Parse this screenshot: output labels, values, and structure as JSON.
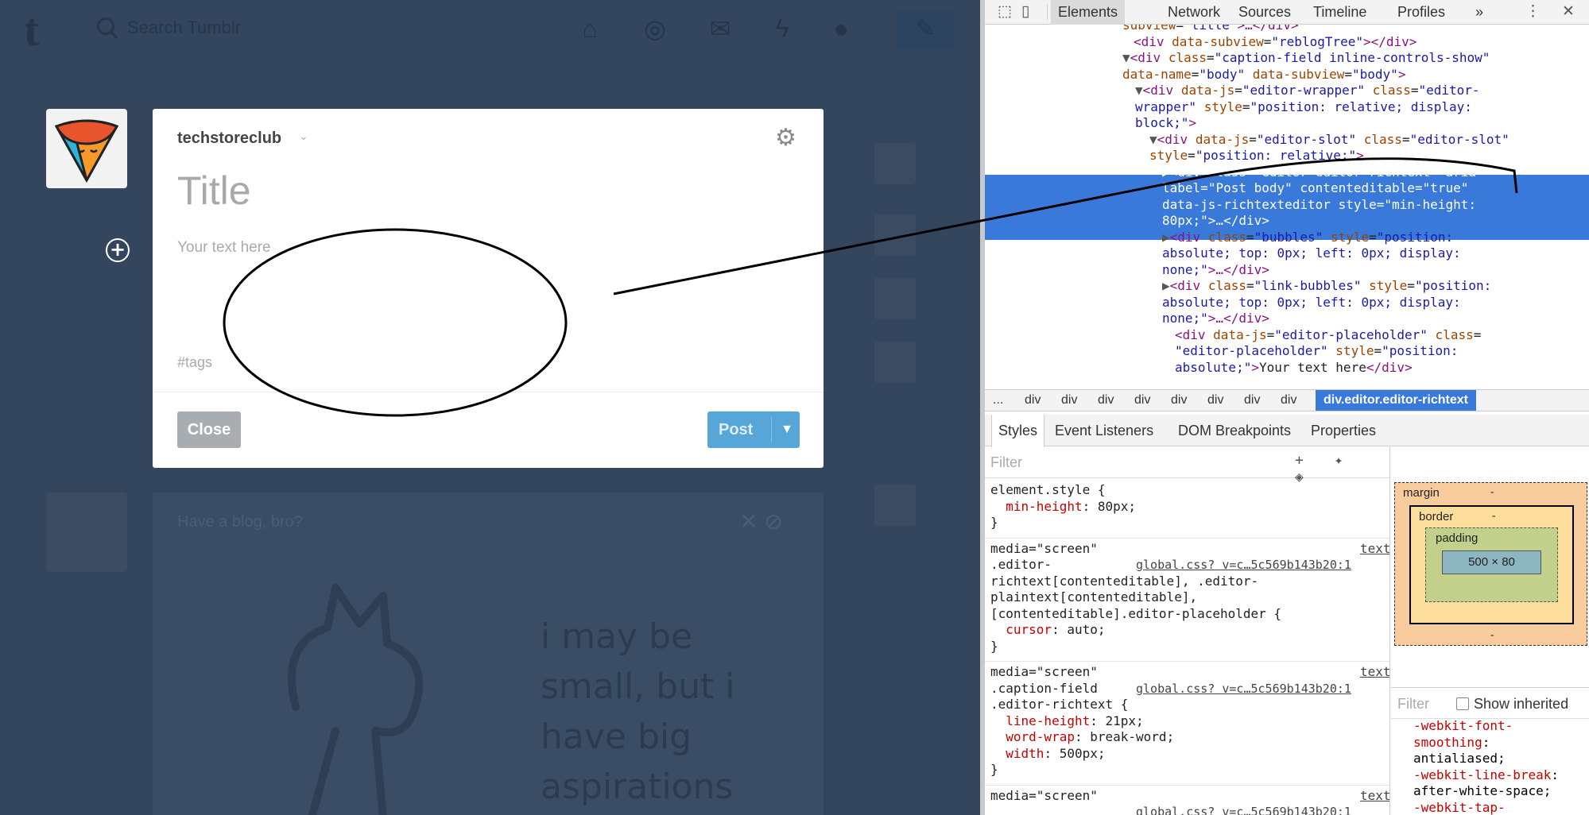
{
  "dashboard": {
    "search_placeholder": "Search Tumblr",
    "nav_icons": [
      "home-icon",
      "explore-icon",
      "inbox-icon",
      "activity-icon",
      "account-icon",
      "compose-icon"
    ]
  },
  "composer": {
    "blog_name": "techstoreclub",
    "title_placeholder": "Title",
    "body_placeholder": "Your text here",
    "tags_placeholder": "#tags",
    "close_label": "Close",
    "post_label": "Post"
  },
  "background_post": {
    "title": "Have a blog, bro?",
    "text": "i may be small, but i have big aspirations"
  },
  "devtools": {
    "tabs": [
      "Elements",
      "Network",
      "Sources",
      "Timeline",
      "Profiles",
      "»"
    ],
    "active_tab": "Elements",
    "dom_lines": [
      {
        "ind": 180,
        "t": [
          [
            "attr",
            "subview"
          ],
          [
            "txt",
            "="
          ],
          [
            "val",
            "\"title\""
          ],
          [
            "tag",
            ">…</div>"
          ]
        ]
      },
      {
        "ind": 194,
        "t": [
          [
            "tag",
            "<div "
          ],
          [
            "attr",
            "data-subview"
          ],
          [
            "txt",
            "="
          ],
          [
            "val",
            "\"reblogTree\""
          ],
          [
            "tag",
            "></div>"
          ]
        ]
      },
      {
        "ind": 180,
        "t": [
          [
            "tri",
            "▼"
          ],
          [
            "tag",
            "<div "
          ],
          [
            "attr",
            "class"
          ],
          [
            "txt",
            "="
          ],
          [
            "val",
            "\"caption-field inline-controls-show\""
          ]
        ]
      },
      {
        "ind": 180,
        "t": [
          [
            "attr",
            "data-name"
          ],
          [
            "txt",
            "="
          ],
          [
            "val",
            "\"body\" "
          ],
          [
            "attr",
            "data-subview"
          ],
          [
            "txt",
            "="
          ],
          [
            "val",
            "\"body\""
          ],
          [
            "tag",
            ">"
          ]
        ]
      },
      {
        "ind": 196,
        "t": [
          [
            "tri",
            "▼"
          ],
          [
            "tag",
            "<div "
          ],
          [
            "attr",
            "data-js"
          ],
          [
            "txt",
            "="
          ],
          [
            "val",
            "\"editor-wrapper\" "
          ],
          [
            "attr",
            "class"
          ],
          [
            "txt",
            "="
          ],
          [
            "val",
            "\"editor-"
          ]
        ]
      },
      {
        "ind": 196,
        "t": [
          [
            "val",
            "wrapper\" "
          ],
          [
            "attr",
            "style"
          ],
          [
            "txt",
            "="
          ],
          [
            "val",
            "\"position: relative; display:"
          ]
        ]
      },
      {
        "ind": 196,
        "t": [
          [
            "val",
            "block;\""
          ],
          [
            "tag",
            ">"
          ]
        ]
      },
      {
        "ind": 214,
        "t": [
          [
            "tri",
            "▼"
          ],
          [
            "tag",
            "<div "
          ],
          [
            "attr",
            "data-js"
          ],
          [
            "txt",
            "="
          ],
          [
            "val",
            "\"editor-slot\" "
          ],
          [
            "attr",
            "class"
          ],
          [
            "txt",
            "="
          ],
          [
            "val",
            "\"editor-slot\""
          ]
        ]
      },
      {
        "ind": 214,
        "t": [
          [
            "attr",
            "style"
          ],
          [
            "txt",
            "="
          ],
          [
            "val",
            "\"position: relative;\""
          ],
          [
            "tag",
            ">"
          ]
        ]
      },
      {
        "ind": 230,
        "t": [
          [
            "tri",
            "▶"
          ],
          [
            "tag",
            "<div "
          ],
          [
            "attr",
            "class"
          ],
          [
            "txt",
            "="
          ],
          [
            "val",
            "\"editor editor-richtext\" "
          ],
          [
            "attr",
            "aria-"
          ]
        ],
        "sel": true
      },
      {
        "ind": 230,
        "t": [
          [
            "attr",
            "label"
          ],
          [
            "txt",
            "="
          ],
          [
            "val",
            "\"Post body\" "
          ],
          [
            "attr",
            "contenteditable"
          ],
          [
            "txt",
            "="
          ],
          [
            "val",
            "\"true\""
          ]
        ],
        "sel": true
      },
      {
        "ind": 230,
        "t": [
          [
            "attr",
            "data-js-richtexteditor "
          ],
          [
            "attr",
            "style"
          ],
          [
            "txt",
            "="
          ],
          [
            "val",
            "\"min-height:"
          ]
        ],
        "sel": true
      },
      {
        "ind": 230,
        "t": [
          [
            "val",
            "80px;\""
          ],
          [
            "tag",
            ">…</div>"
          ]
        ],
        "sel": true
      },
      {
        "ind": 230,
        "t": [
          [
            "tri",
            "▶"
          ],
          [
            "tag",
            "<div "
          ],
          [
            "attr",
            "class"
          ],
          [
            "txt",
            "="
          ],
          [
            "val",
            "\"bubbles\" "
          ],
          [
            "attr",
            "style"
          ],
          [
            "txt",
            "="
          ],
          [
            "val",
            "\"position:"
          ]
        ]
      },
      {
        "ind": 230,
        "t": [
          [
            "val",
            "absolute; top: 0px; left: 0px; display:"
          ]
        ]
      },
      {
        "ind": 230,
        "t": [
          [
            "val",
            "none;\""
          ],
          [
            "tag",
            ">…</div>"
          ]
        ]
      },
      {
        "ind": 230,
        "t": [
          [
            "tri",
            "▶"
          ],
          [
            "tag",
            "<div "
          ],
          [
            "attr",
            "class"
          ],
          [
            "txt",
            "="
          ],
          [
            "val",
            "\"link-bubbles\" "
          ],
          [
            "attr",
            "style"
          ],
          [
            "txt",
            "="
          ],
          [
            "val",
            "\"position:"
          ]
        ]
      },
      {
        "ind": 230,
        "t": [
          [
            "val",
            "absolute; top: 0px; left: 0px; display:"
          ]
        ]
      },
      {
        "ind": 230,
        "t": [
          [
            "val",
            "none;\""
          ],
          [
            "tag",
            ">…</div>"
          ]
        ]
      },
      {
        "ind": 246,
        "t": [
          [
            "tag",
            "<div "
          ],
          [
            "attr",
            "data-js"
          ],
          [
            "txt",
            "="
          ],
          [
            "val",
            "\"editor-placeholder\" "
          ],
          [
            "attr",
            "class"
          ],
          [
            "txt",
            "="
          ]
        ]
      },
      {
        "ind": 246,
        "t": [
          [
            "val",
            "\"editor-placeholder\" "
          ],
          [
            "attr",
            "style"
          ],
          [
            "txt",
            "="
          ],
          [
            "val",
            "\"position:"
          ]
        ]
      },
      {
        "ind": 246,
        "t": [
          [
            "val",
            "absolute;\""
          ],
          [
            "tag",
            ">"
          ],
          [
            "txt",
            "Your text here"
          ],
          [
            "tag",
            "</div>"
          ]
        ]
      }
    ],
    "breadcrumbs": [
      "...",
      "div",
      "div",
      "div",
      "div",
      "div",
      "div",
      "div",
      "div"
    ],
    "breadcrumb_active": "div.editor.editor-richtext",
    "sub_tabs": [
      "Styles",
      "Event Listeners",
      "DOM Breakpoints",
      "Properties"
    ],
    "styles_filter_placeholder": "Filter",
    "styles_rules": [
      {
        "lines": [
          [
            "sel-name",
            "element.style {"
          ],
          [
            "p",
            "  min-height",
            ": 80px;"
          ],
          [
            "sel-name",
            "}"
          ]
        ]
      },
      {
        "media": "media=\"screen\"",
        "source_label": "text",
        "source_file": "global.css? v=c…5c569b143b20:1",
        "lines": [
          [
            "sel-name",
            ".editor-"
          ],
          [
            "sel-name",
            "richtext[contenteditable], .editor-"
          ],
          [
            "sel-name",
            "plaintext[contenteditable],"
          ],
          [
            "sel-name",
            "[contenteditable].editor-placeholder {"
          ],
          [
            "p",
            "  cursor",
            ": auto;"
          ],
          [
            "sel-name",
            "}"
          ]
        ]
      },
      {
        "media": "media=\"screen\"",
        "source_label": "text",
        "source_file": "global.css? v=c…5c569b143b20:1",
        "lines": [
          [
            "sel-name",
            ".caption-field"
          ],
          [
            "sel-name",
            ".editor-richtext {"
          ],
          [
            "p",
            "  line-height",
            ": 21px;"
          ],
          [
            "p",
            "  word-wrap",
            ": break-word;"
          ],
          [
            "p",
            "  width",
            ": 500px;"
          ],
          [
            "sel-name",
            "}"
          ]
        ]
      },
      {
        "media": "media=\"screen\"",
        "source_label": "text",
        "source_file": "global.css? v=c…5c569b143b20:1",
        "lines": []
      }
    ],
    "box_model": {
      "margin_label": "margin",
      "border_label": "border",
      "padding_label": "padding",
      "content_size": "500 × 80",
      "dash": "-"
    },
    "computed_filter_placeholder": "Filter",
    "show_inherited_label": "Show inherited",
    "computed_props": [
      [
        "-webkit-font-",
        ""
      ],
      [
        "smoothing",
        ":"
      ],
      [
        "",
        "antialiased;"
      ],
      [
        "-webkit-line-break",
        ":"
      ],
      [
        "",
        "after-white-space;"
      ],
      [
        "-webkit-tap-",
        ""
      ]
    ]
  }
}
